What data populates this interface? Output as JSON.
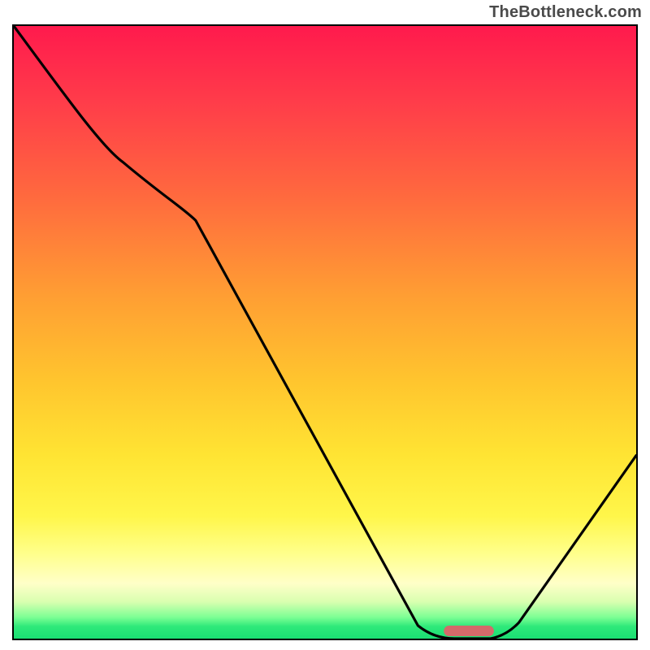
{
  "watermark": "TheBottleneck.com",
  "chart_data": {
    "type": "line",
    "title": "",
    "xlabel": "",
    "ylabel": "",
    "xlim": [
      0,
      100
    ],
    "ylim": [
      0,
      100
    ],
    "grid": false,
    "legend": false,
    "series": [
      {
        "name": "bottleneck-curve",
        "x": [
          0,
          17,
          28,
          70,
          75,
          80,
          100
        ],
        "y": [
          100,
          78,
          70,
          0,
          0,
          2,
          30
        ]
      }
    ],
    "marker": {
      "name": "optimal-range",
      "x_range": [
        70,
        78
      ],
      "y": 0.5,
      "color": "#d46a6a"
    },
    "background_gradient_stops": [
      {
        "pos": 0,
        "color": "#ff1a4d"
      },
      {
        "pos": 12,
        "color": "#ff3b4a"
      },
      {
        "pos": 28,
        "color": "#ff6a3e"
      },
      {
        "pos": 44,
        "color": "#ff9e33"
      },
      {
        "pos": 58,
        "color": "#ffc52e"
      },
      {
        "pos": 70,
        "color": "#ffe433"
      },
      {
        "pos": 80,
        "color": "#fff64a"
      },
      {
        "pos": 86,
        "color": "#ffff8a"
      },
      {
        "pos": 91,
        "color": "#ffffc8"
      },
      {
        "pos": 94,
        "color": "#d9ffb0"
      },
      {
        "pos": 96.5,
        "color": "#7dff94"
      },
      {
        "pos": 98,
        "color": "#2fe97a"
      },
      {
        "pos": 100,
        "color": "#1adf73"
      }
    ]
  }
}
